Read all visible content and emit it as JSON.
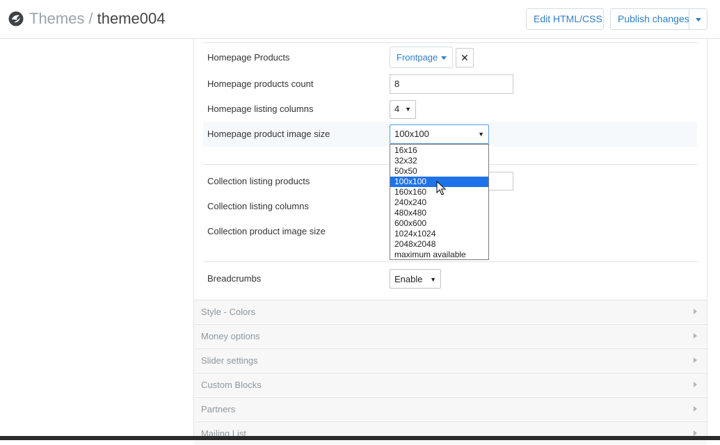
{
  "header": {
    "breadcrumb_root": "Themes",
    "breadcrumb_sep": "/",
    "breadcrumb_current": "theme004",
    "edit_button": "Edit HTML/CSS",
    "publish_button": "Publish changes",
    "logo_icon": "shopify-bag-icon"
  },
  "homepage": {
    "products_label": "Homepage Products",
    "products_value": "Frontpage",
    "remove_label": "✕",
    "count_label": "Homepage products count",
    "count_value": "8",
    "columns_label": "Homepage listing columns",
    "columns_value": "4",
    "image_size_label": "Homepage product image size",
    "image_size_value": "100x100"
  },
  "dropdown": {
    "options": [
      "16x16",
      "32x32",
      "50x50",
      "100x100",
      "160x160",
      "240x240",
      "480x480",
      "600x600",
      "1024x1024",
      "2048x2048",
      "maximum available"
    ],
    "selected_index": 3
  },
  "collection": {
    "products_label": "Collection listing products",
    "columns_label": "Collection listing columns",
    "image_size_label": "Collection product image size"
  },
  "breadcrumbs": {
    "label": "Breadcrumbs",
    "value": "Enable"
  },
  "sections": [
    "Style - Colors",
    "Money options",
    "Slider settings",
    "Custom Blocks",
    "Partners",
    "Mailing List"
  ],
  "colors": {
    "accent": "#2f7ec8",
    "selected_option": "#1e73e8",
    "muted_text": "#8e979e"
  }
}
